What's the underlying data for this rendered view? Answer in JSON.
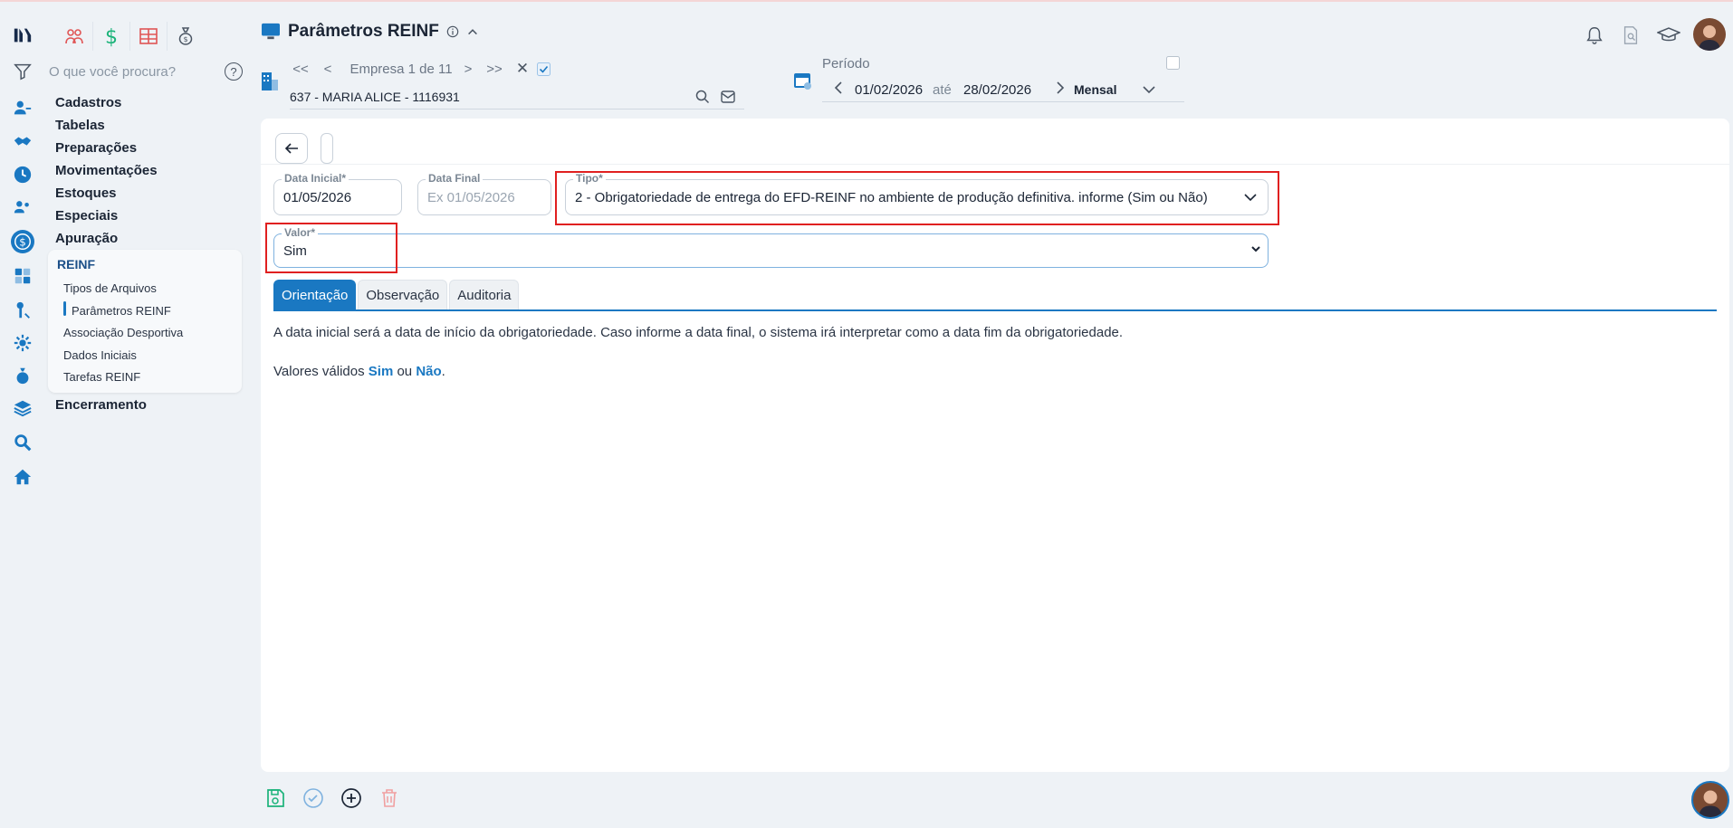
{
  "header": {
    "title": "Parâmetros REINF",
    "nav_first": "<<",
    "nav_prev": "<",
    "nav_position": "Empresa 1 de 11",
    "nav_next": ">",
    "nav_last": ">>",
    "company": "637 - MARIA ALICE - 1116931"
  },
  "periodo": {
    "label": "Período",
    "start": "01/02/2026",
    "sep": "até",
    "end": "28/02/2026",
    "frequency": "Mensal"
  },
  "sidebar": {
    "search_placeholder": "O que você procura?",
    "items": [
      "Cadastros",
      "Tabelas",
      "Preparações",
      "Movimentações",
      "Estoques",
      "Especiais",
      "Apuração"
    ],
    "submenu_title": "REINF",
    "submenu_items": [
      "Tipos de Arquivos",
      "Parâmetros REINF",
      "Associação Desportiva",
      "Dados Iniciais",
      "Tarefas REINF"
    ],
    "after_item": "Encerramento"
  },
  "form": {
    "data_inicial_label": "Data Inicial*",
    "data_inicial_value": "01/05/2026",
    "data_final_label": "Data Final",
    "data_final_placeholder": "Ex 01/05/2026",
    "tipo_label": "Tipo*",
    "tipo_value": "2 - Obrigatoriedade de entrega do EFD-REINF no ambiente de produção definitiva. informe (Sim ou Não)",
    "valor_label": "Valor*",
    "valor_value": "Sim"
  },
  "tabs": [
    "Orientação",
    "Observação",
    "Auditoria"
  ],
  "content": {
    "line1": "A data inicial será a data de início da obrigatoriedade. Caso informe a data final, o sistema irá interpretar como a data fim da obrigatoriedade.",
    "line2_prefix": "Valores válidos ",
    "line2_sim": "Sim",
    "line2_mid": " ou ",
    "line2_nao": "Não",
    "line2_suffix": "."
  },
  "colors": {
    "accent": "#1a78c2",
    "highlight": "#e02020"
  }
}
